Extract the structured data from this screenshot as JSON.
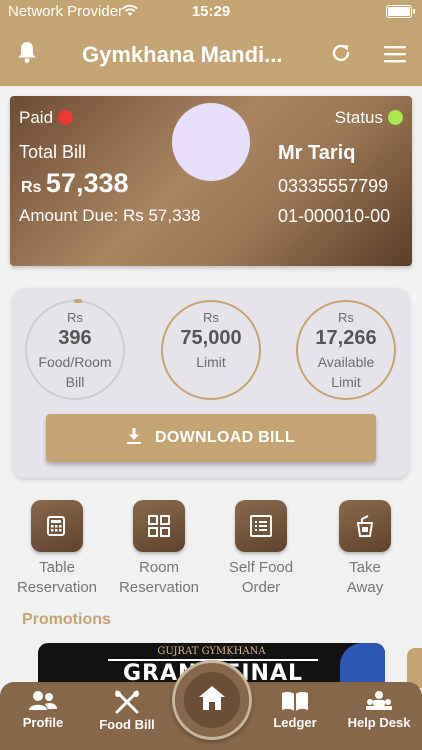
{
  "status_bar": {
    "carrier": "Network Provider",
    "time": "15:29"
  },
  "app_bar": {
    "title": "Gymkhana Mandi..."
  },
  "bill_card": {
    "paid_label": "Paid",
    "paid_dot_color": "#e93a36",
    "status_label": "Status",
    "status_dot_color": "#a7e84e",
    "total_label": "Total Bill",
    "currency": "Rs",
    "total_amount": "57,338",
    "amount_due": "Amount Due: Rs 57,338",
    "name": "Mr Tariq",
    "phone": "03335557799",
    "account": "01-000010-00"
  },
  "stats": [
    {
      "currency": "Rs",
      "value": "396",
      "label_1": "Food/Room",
      "label_2": "Bill"
    },
    {
      "currency": "Rs",
      "value": "75,000",
      "label_1": "Limit",
      "label_2": ""
    },
    {
      "currency": "Rs",
      "value": "17,266",
      "label_1": "Available",
      "label_2": "Limit"
    }
  ],
  "download_button": "DOWNLOAD BILL",
  "actions": [
    {
      "line_1": "Table",
      "line_2": "Reservation",
      "icon": "table-reservation-icon"
    },
    {
      "line_1": "Room",
      "line_2": "Reservation",
      "icon": "room-reservation-icon"
    },
    {
      "line_1": "Self Food",
      "line_2": "Order",
      "icon": "food-order-icon"
    },
    {
      "line_1": "Take",
      "line_2": "Away",
      "icon": "take-away-icon"
    }
  ],
  "promotions": {
    "title": "Promotions",
    "banner_top": "GUJRAT GYMKHANA",
    "banner_word": "GRAND FINAL"
  },
  "bottom_nav": [
    {
      "label": "Profile",
      "icon": "profile-icon"
    },
    {
      "label": "Food Bill",
      "icon": "food-bill-icon"
    },
    {
      "label": "",
      "icon": "home-icon"
    },
    {
      "label": "Ledger",
      "icon": "ledger-icon"
    },
    {
      "label": "Help Desk",
      "icon": "help-desk-icon"
    }
  ],
  "colors": {
    "brand": "#c4a472",
    "nav": "#86674a"
  }
}
